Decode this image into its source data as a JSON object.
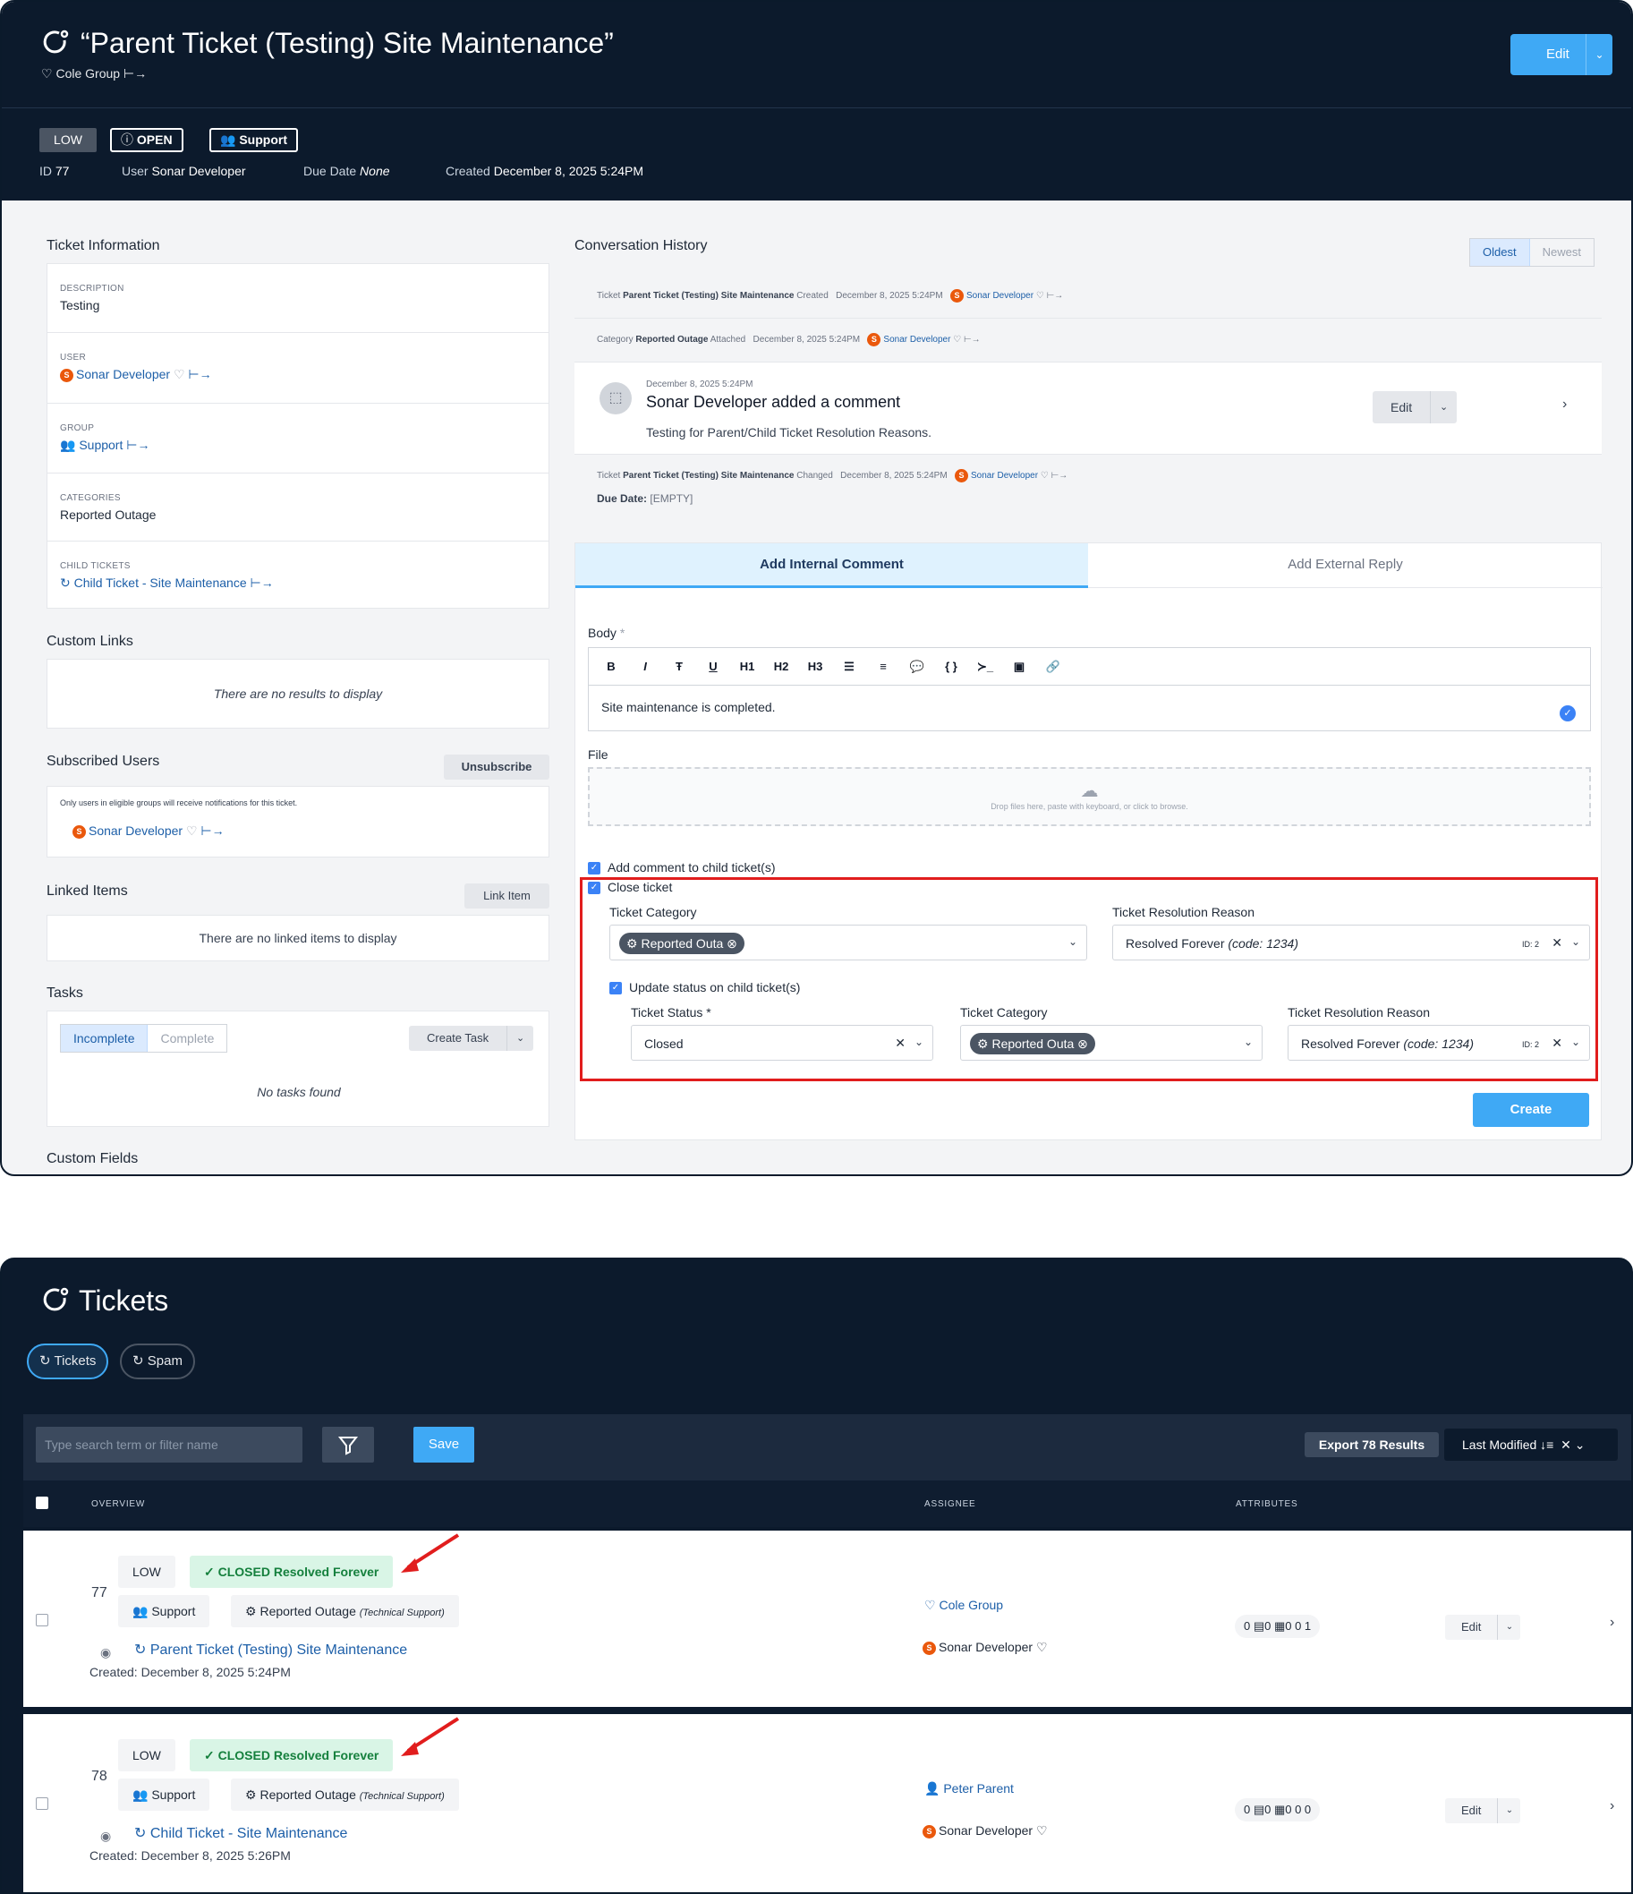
{
  "ticket": {
    "title": "“Parent Ticket (Testing) Site Maintenance”",
    "group_name": "Cole Group",
    "edit_label": "Edit",
    "badges": {
      "priority": "LOW",
      "status": "OPEN",
      "group": "Support"
    },
    "meta": {
      "id_label": "ID",
      "id_value": "77",
      "user_label": "User",
      "user_value": "Sonar Developer",
      "due_label": "Due Date",
      "due_value": "None",
      "created_label": "Created",
      "created_value": "December 8, 2025 5:24PM"
    }
  },
  "info": {
    "title": "Ticket Information",
    "description_label": "DESCRIPTION",
    "description_value": "Testing",
    "user_label": "USER",
    "user_value": "Sonar Developer",
    "group_label": "GROUP",
    "group_value": "Support",
    "categories_label": "CATEGORIES",
    "categories_value": "Reported Outage",
    "child_label": "CHILD TICKETS",
    "child_value": "Child Ticket - Site Maintenance"
  },
  "custom_links": {
    "title": "Custom Links",
    "empty": "There are no results to display"
  },
  "subscribed": {
    "title": "Subscribed Users",
    "button": "Unsubscribe",
    "note": "Only users in eligible groups will receive notifications for this ticket.",
    "user": "Sonar Developer"
  },
  "linked": {
    "title": "Linked Items",
    "button": "Link Item",
    "empty": "There are no linked items to display"
  },
  "tasks": {
    "title": "Tasks",
    "tab_incomplete": "Incomplete",
    "tab_complete": "Complete",
    "create": "Create Task",
    "empty": "No tasks found"
  },
  "custom_fields": {
    "title": "Custom Fields"
  },
  "conversation": {
    "title": "Conversation History",
    "sort_oldest": "Oldest",
    "sort_newest": "Newest",
    "ev1": {
      "pre": "Ticket",
      "bold": "Parent Ticket (Testing) Site Maintenance",
      "action": "Created",
      "date": "December 8, 2025 5:24PM",
      "user": "Sonar Developer"
    },
    "ev2": {
      "pre": "Category",
      "bold": "Reported Outage",
      "action": "Attached",
      "date": "December 8, 2025 5:24PM",
      "user": "Sonar Developer"
    },
    "comment": {
      "date": "December 8, 2025 5:24PM",
      "heading": "Sonar Developer added a comment",
      "body": "Testing for Parent/Child Ticket Resolution Reasons.",
      "edit": "Edit"
    },
    "ev3": {
      "pre": "Ticket",
      "bold": "Parent Ticket (Testing) Site Maintenance",
      "action": "Changed",
      "date": "December 8, 2025 5:24PM",
      "user": "Sonar Developer",
      "due_label": "Due Date:",
      "due_value": "[EMPTY]"
    }
  },
  "composer": {
    "tab_internal": "Add Internal Comment",
    "tab_external": "Add External Reply",
    "body_label": "Body",
    "body_required": "*",
    "toolbar": [
      "B",
      "I",
      "Ŧ",
      "U",
      "H1",
      "H2",
      "H3",
      "☰",
      "≡",
      "💬",
      "{ }",
      "≻_",
      "▣",
      "🔗"
    ],
    "body_text": "Site maintenance is completed.",
    "file_label": "File",
    "drop_text": "Drop files here, paste with keyboard, or click to browse.",
    "add_child_comment": "Add comment to child ticket(s)",
    "close_ticket": "Close ticket",
    "category_label": "Ticket Category",
    "category_value": "Reported Outa",
    "reason_label": "Ticket Resolution Reason",
    "reason_value": "Resolved Forever",
    "reason_code": "(code: 1234)",
    "reason_id": "ID: 2",
    "update_child": "Update status on child ticket(s)",
    "status_label": "Ticket Status",
    "status_value": "Closed",
    "create": "Create"
  },
  "tickets": {
    "title": "Tickets",
    "tab_tickets": "Tickets",
    "tab_spam": "Spam",
    "search_placeholder": "Type search term or filter name",
    "save": "Save",
    "export": "Export 78 Results",
    "sort": "Last Modified",
    "col_overview": "OVERVIEW",
    "col_assignee": "ASSIGNEE",
    "col_attributes": "ATTRIBUTES",
    "rows": [
      {
        "id": "77",
        "priority": "LOW",
        "status": "CLOSED Resolved Forever",
        "group": "Support",
        "category": "Reported Outage",
        "category_sub": "(Technical Support)",
        "name": "Parent Ticket (Testing) Site Maintenance",
        "created": "Created: December 8, 2025 5:24PM",
        "assignee": "Cole Group",
        "user": "Sonar Developer",
        "attrs": "0 ▤0 ▦0 0 1",
        "edit": "Edit"
      },
      {
        "id": "78",
        "priority": "LOW",
        "status": "CLOSED Resolved Forever",
        "group": "Support",
        "category": "Reported Outage",
        "category_sub": "(Technical Support)",
        "name": "Child Ticket - Site Maintenance",
        "created": "Created: December 8, 2025 5:26PM",
        "assignee": "Peter Parent",
        "user": "Sonar Developer",
        "attrs": "0 ▤0 ▦0 0 0",
        "edit": "Edit"
      }
    ]
  },
  "colors": {
    "navy": "#0c1a2c",
    "accent": "#3fa9f5",
    "annotation": "#e11d1d",
    "closed": "#15803d"
  }
}
